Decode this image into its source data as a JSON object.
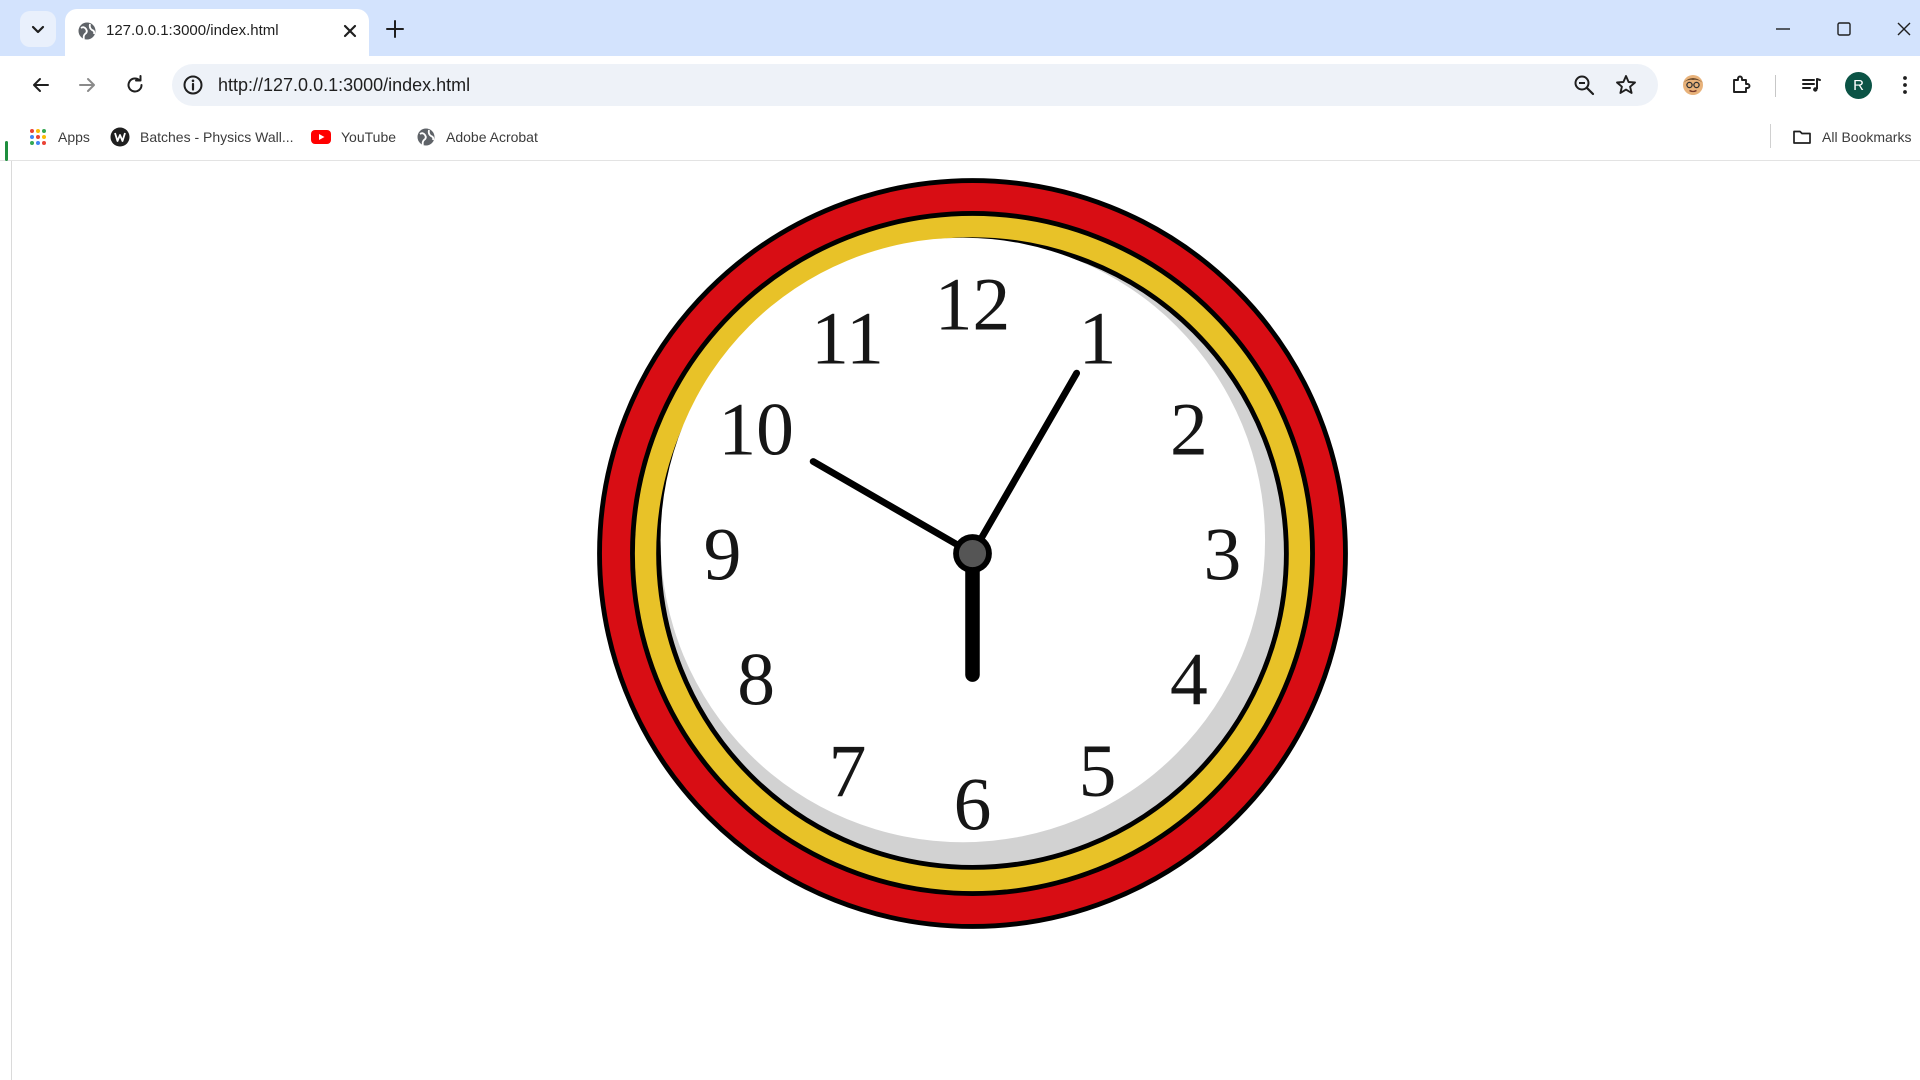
{
  "browser": {
    "tab": {
      "title": "127.0.0.1:3000/index.html"
    },
    "address_bar": {
      "url": "http://127.0.0.1:3000/index.html"
    },
    "profile": {
      "initial": "R",
      "color": "#0b5345"
    },
    "bookmarks": [
      {
        "label": "Apps",
        "icon": "apps-grid-icon"
      },
      {
        "label": "Batches - Physics Wall...",
        "icon": "physics-wallah-icon"
      },
      {
        "label": "YouTube",
        "icon": "youtube-icon"
      },
      {
        "label": "Adobe Acrobat",
        "icon": "globe-icon"
      }
    ],
    "all_bookmarks_label": "All Bookmarks",
    "colors": {
      "tabstrip": "#d3e3fd",
      "omnibox": "#eef2f8"
    }
  },
  "clock": {
    "numerals": [
      "12",
      "1",
      "2",
      "3",
      "4",
      "5",
      "6",
      "7",
      "8",
      "9",
      "10",
      "11"
    ],
    "time_shown": {
      "hour_hand_points_to": 6,
      "minute_hand_points_to": 10,
      "second_hand_points_to": 1
    },
    "colors": {
      "outer_ring": "#d80d14",
      "inner_ring": "#e8c228",
      "face": "#ffffff",
      "shadow": "#d2d2d2",
      "hands": "#000000"
    }
  }
}
